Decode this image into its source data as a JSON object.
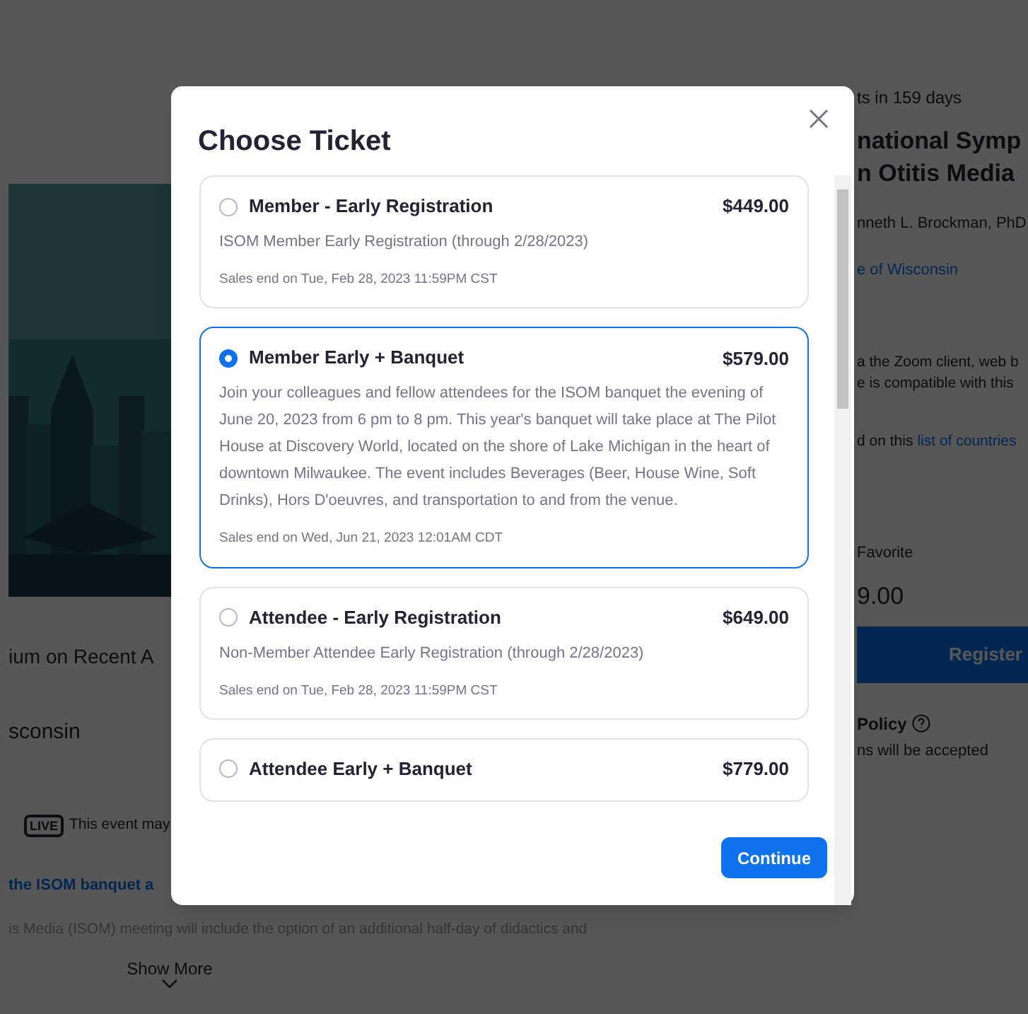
{
  "background": {
    "left": {
      "title": "ium on Recent A",
      "location": "sconsin",
      "live_badge": "LIVE",
      "live_note": "This event may",
      "banquet_link": "the ISOM banquet a",
      "description": "is Media (ISOM) meeting will include the option of an additional half-day of didactics and",
      "show_more": "Show More"
    },
    "right": {
      "countdown": "ts in 159 days",
      "title_lines": [
        "national Symp",
        "n Otitis Media"
      ],
      "organizer": "nneth L. Brockman, PhD",
      "organization_link": "e of Wisconsin",
      "online_note_lines": [
        "a the Zoom client, web b",
        "e is compatible with this"
      ],
      "countries_text": "d on this",
      "countries_link": "list of countries",
      "favorite": "Favorite",
      "price": "9.00",
      "register_button": "Register",
      "policy_title": "Policy",
      "policy_note": "ns will be accepted"
    }
  },
  "modal": {
    "title": "Choose Ticket",
    "tickets": [
      {
        "name": "Member - Early Registration",
        "price": "$449.00",
        "description": "ISOM Member Early Registration (through 2/28/2023)",
        "sales_end": "Sales end on Tue, Feb 28, 2023 11:59PM CST",
        "selected": false
      },
      {
        "name": "Member Early + Banquet",
        "price": "$579.00",
        "description": "Join your colleagues and fellow attendees for the ISOM banquet the evening of June 20, 2023 from 6 pm to 8 pm. This year's banquet will take place at The Pilot House at Discovery World, located on the shore of Lake Michigan in the heart of downtown Milwaukee. The event includes Beverages (Beer, House Wine, Soft Drinks), Hors D'oeuvres, and transportation to and from the venue.",
        "sales_end": "Sales end on Wed, Jun 21, 2023 12:01AM CDT",
        "selected": true
      },
      {
        "name": "Attendee - Early Registration",
        "price": "$649.00",
        "description": "Non-Member Attendee Early Registration (through 2/28/2023)",
        "sales_end": "Sales end on Tue, Feb 28, 2023 11:59PM CST",
        "selected": false
      },
      {
        "name": "Attendee Early + Banquet",
        "price": "$779.00",
        "selected": false
      }
    ],
    "continue_button": "Continue"
  }
}
